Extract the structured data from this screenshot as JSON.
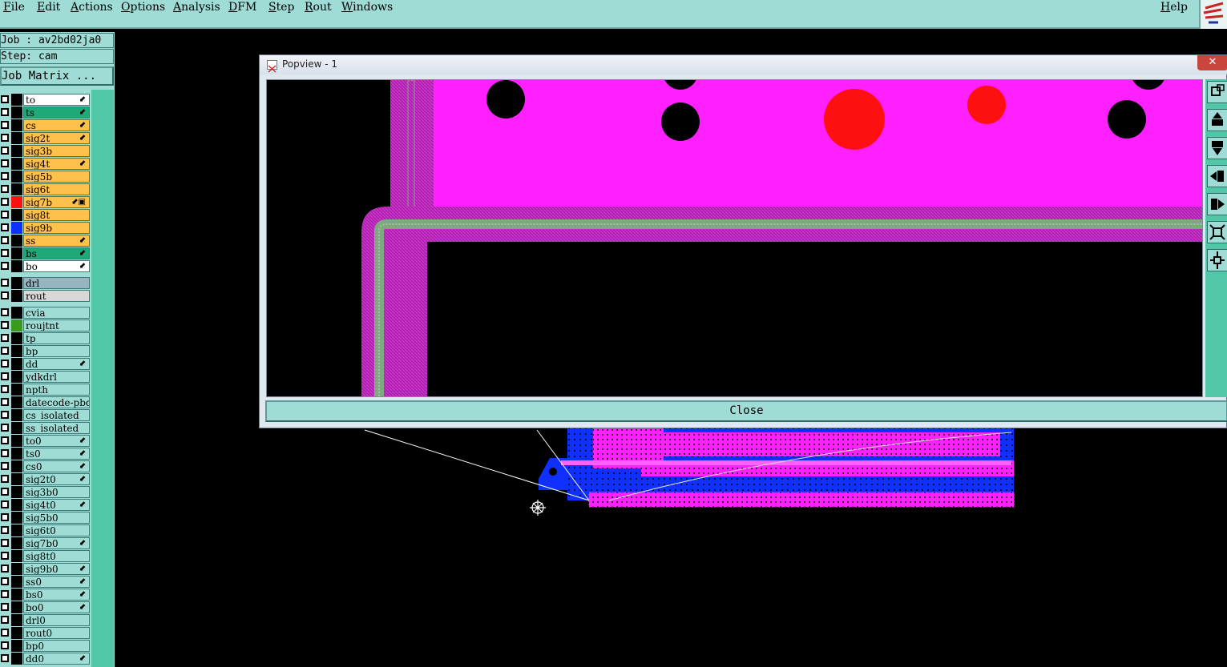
{
  "menu": [
    "File",
    "Edit",
    "Actions",
    "Options",
    "Analysis",
    "DFM",
    "Step",
    "Rout",
    "Windows"
  ],
  "help": "Help",
  "job": {
    "job_line": "Job : av2bd02ja0",
    "step_line": "Step: cam",
    "matrix_button": "Job Matrix ..."
  },
  "layers": [
    {
      "name": "to",
      "color": "#ffffff",
      "flag": "⬋",
      "swatch": "#000000"
    },
    {
      "name": "ts",
      "color": "#20a878",
      "flag": "⬋",
      "swatch": "#000000"
    },
    {
      "name": "cs",
      "color": "#ffc04c",
      "flag": "⬋",
      "swatch": "#000000"
    },
    {
      "name": "sig2t",
      "color": "#ffc04c",
      "flag": "⬋",
      "swatch": "#000000"
    },
    {
      "name": "sig3b",
      "color": "#ffc04c",
      "flag": "",
      "swatch": "#000000"
    },
    {
      "name": "sig4t",
      "color": "#ffc04c",
      "flag": "⬋",
      "swatch": "#000000"
    },
    {
      "name": "sig5b",
      "color": "#ffc04c",
      "flag": "",
      "swatch": "#000000"
    },
    {
      "name": "sig6t",
      "color": "#ffc04c",
      "flag": "",
      "swatch": "#000000"
    },
    {
      "name": "sig7b",
      "color": "#ffc04c",
      "flag": "⬋▣",
      "swatch": "#ff1010"
    },
    {
      "name": "sig8t",
      "color": "#ffc04c",
      "flag": "",
      "swatch": "#000000"
    },
    {
      "name": "sig9b",
      "color": "#ffc04c",
      "flag": "",
      "swatch": "#1030ff"
    },
    {
      "name": "ss",
      "color": "#ffc04c",
      "flag": "⬋",
      "swatch": "#000000"
    },
    {
      "name": "bs",
      "color": "#20a878",
      "flag": "⬋",
      "swatch": "#000000"
    },
    {
      "name": "bo",
      "color": "#ffffff",
      "flag": "⬋",
      "swatch": "#000000"
    },
    {
      "name": "drl",
      "color": "#98b4c0",
      "flag": "",
      "swatch": "#000000"
    },
    {
      "name": "rout",
      "color": "#d8d8d8",
      "flag": "",
      "swatch": "#000000"
    },
    {
      "name": "cvia",
      "color": "#a0dcd6",
      "flag": "",
      "swatch": "#000000"
    },
    {
      "name": "roujtnt",
      "color": "#a0dcd6",
      "flag": "",
      "swatch": "#3a9a20"
    },
    {
      "name": "tp",
      "color": "#a0dcd6",
      "flag": "",
      "swatch": "#000000"
    },
    {
      "name": "bp",
      "color": "#a0dcd6",
      "flag": "",
      "swatch": "#000000"
    },
    {
      "name": "dd",
      "color": "#a0dcd6",
      "flag": "⬋",
      "swatch": "#000000"
    },
    {
      "name": "ydkdrl",
      "color": "#a0dcd6",
      "flag": "",
      "swatch": "#000000"
    },
    {
      "name": "npth",
      "color": "#a0dcd6",
      "flag": "",
      "swatch": "#000000"
    },
    {
      "name": "datecode-pbd",
      "color": "#a0dcd6",
      "flag": "",
      "swatch": "#000000"
    },
    {
      "name": "cs_isolated_",
      "color": "#a0dcd6",
      "flag": "",
      "swatch": "#000000"
    },
    {
      "name": "ss_isolated_",
      "color": "#a0dcd6",
      "flag": "",
      "swatch": "#000000"
    },
    {
      "name": "to0",
      "color": "#a0dcd6",
      "flag": "⬋",
      "swatch": "#000000"
    },
    {
      "name": "ts0",
      "color": "#a0dcd6",
      "flag": "⬋",
      "swatch": "#000000"
    },
    {
      "name": "cs0",
      "color": "#a0dcd6",
      "flag": "⬋",
      "swatch": "#000000"
    },
    {
      "name": "sig2t0",
      "color": "#a0dcd6",
      "flag": "⬋",
      "swatch": "#000000"
    },
    {
      "name": "sig3b0",
      "color": "#a0dcd6",
      "flag": "",
      "swatch": "#000000"
    },
    {
      "name": "sig4t0",
      "color": "#a0dcd6",
      "flag": "⬋",
      "swatch": "#000000"
    },
    {
      "name": "sig5b0",
      "color": "#a0dcd6",
      "flag": "",
      "swatch": "#000000"
    },
    {
      "name": "sig6t0",
      "color": "#a0dcd6",
      "flag": "",
      "swatch": "#000000"
    },
    {
      "name": "sig7b0",
      "color": "#a0dcd6",
      "flag": "⬋",
      "swatch": "#000000"
    },
    {
      "name": "sig8t0",
      "color": "#a0dcd6",
      "flag": "",
      "swatch": "#000000"
    },
    {
      "name": "sig9b0",
      "color": "#a0dcd6",
      "flag": "⬋",
      "swatch": "#000000"
    },
    {
      "name": "ss0",
      "color": "#a0dcd6",
      "flag": "⬋",
      "swatch": "#000000"
    },
    {
      "name": "bs0",
      "color": "#a0dcd6",
      "flag": "⬋",
      "swatch": "#000000"
    },
    {
      "name": "bo0",
      "color": "#a0dcd6",
      "flag": "⬋",
      "swatch": "#000000"
    },
    {
      "name": "drl0",
      "color": "#a0dcd6",
      "flag": "",
      "swatch": "#000000"
    },
    {
      "name": "rout0",
      "color": "#a0dcd6",
      "flag": "",
      "swatch": "#000000"
    },
    {
      "name": "bp0",
      "color": "#a0dcd6",
      "flag": "",
      "swatch": "#000000"
    },
    {
      "name": "dd0",
      "color": "#a0dcd6",
      "flag": "⬋",
      "swatch": "#000000"
    }
  ],
  "popview": {
    "title": "Popview - 1",
    "close_x": "✕",
    "close_button": "Close",
    "tool_icons": [
      "zoom-window-icon",
      "pan-up-icon",
      "pan-down-icon",
      "pan-left-icon",
      "pan-right-icon",
      "zoom-fit-icon",
      "zoom-center-icon"
    ]
  },
  "colors": {
    "panel": "#a0dcd6",
    "accent": "#50c8a8",
    "copper": "#ff20ff",
    "drill": "#ff1010",
    "plane": "#1030ff",
    "outline": "#80a880"
  }
}
